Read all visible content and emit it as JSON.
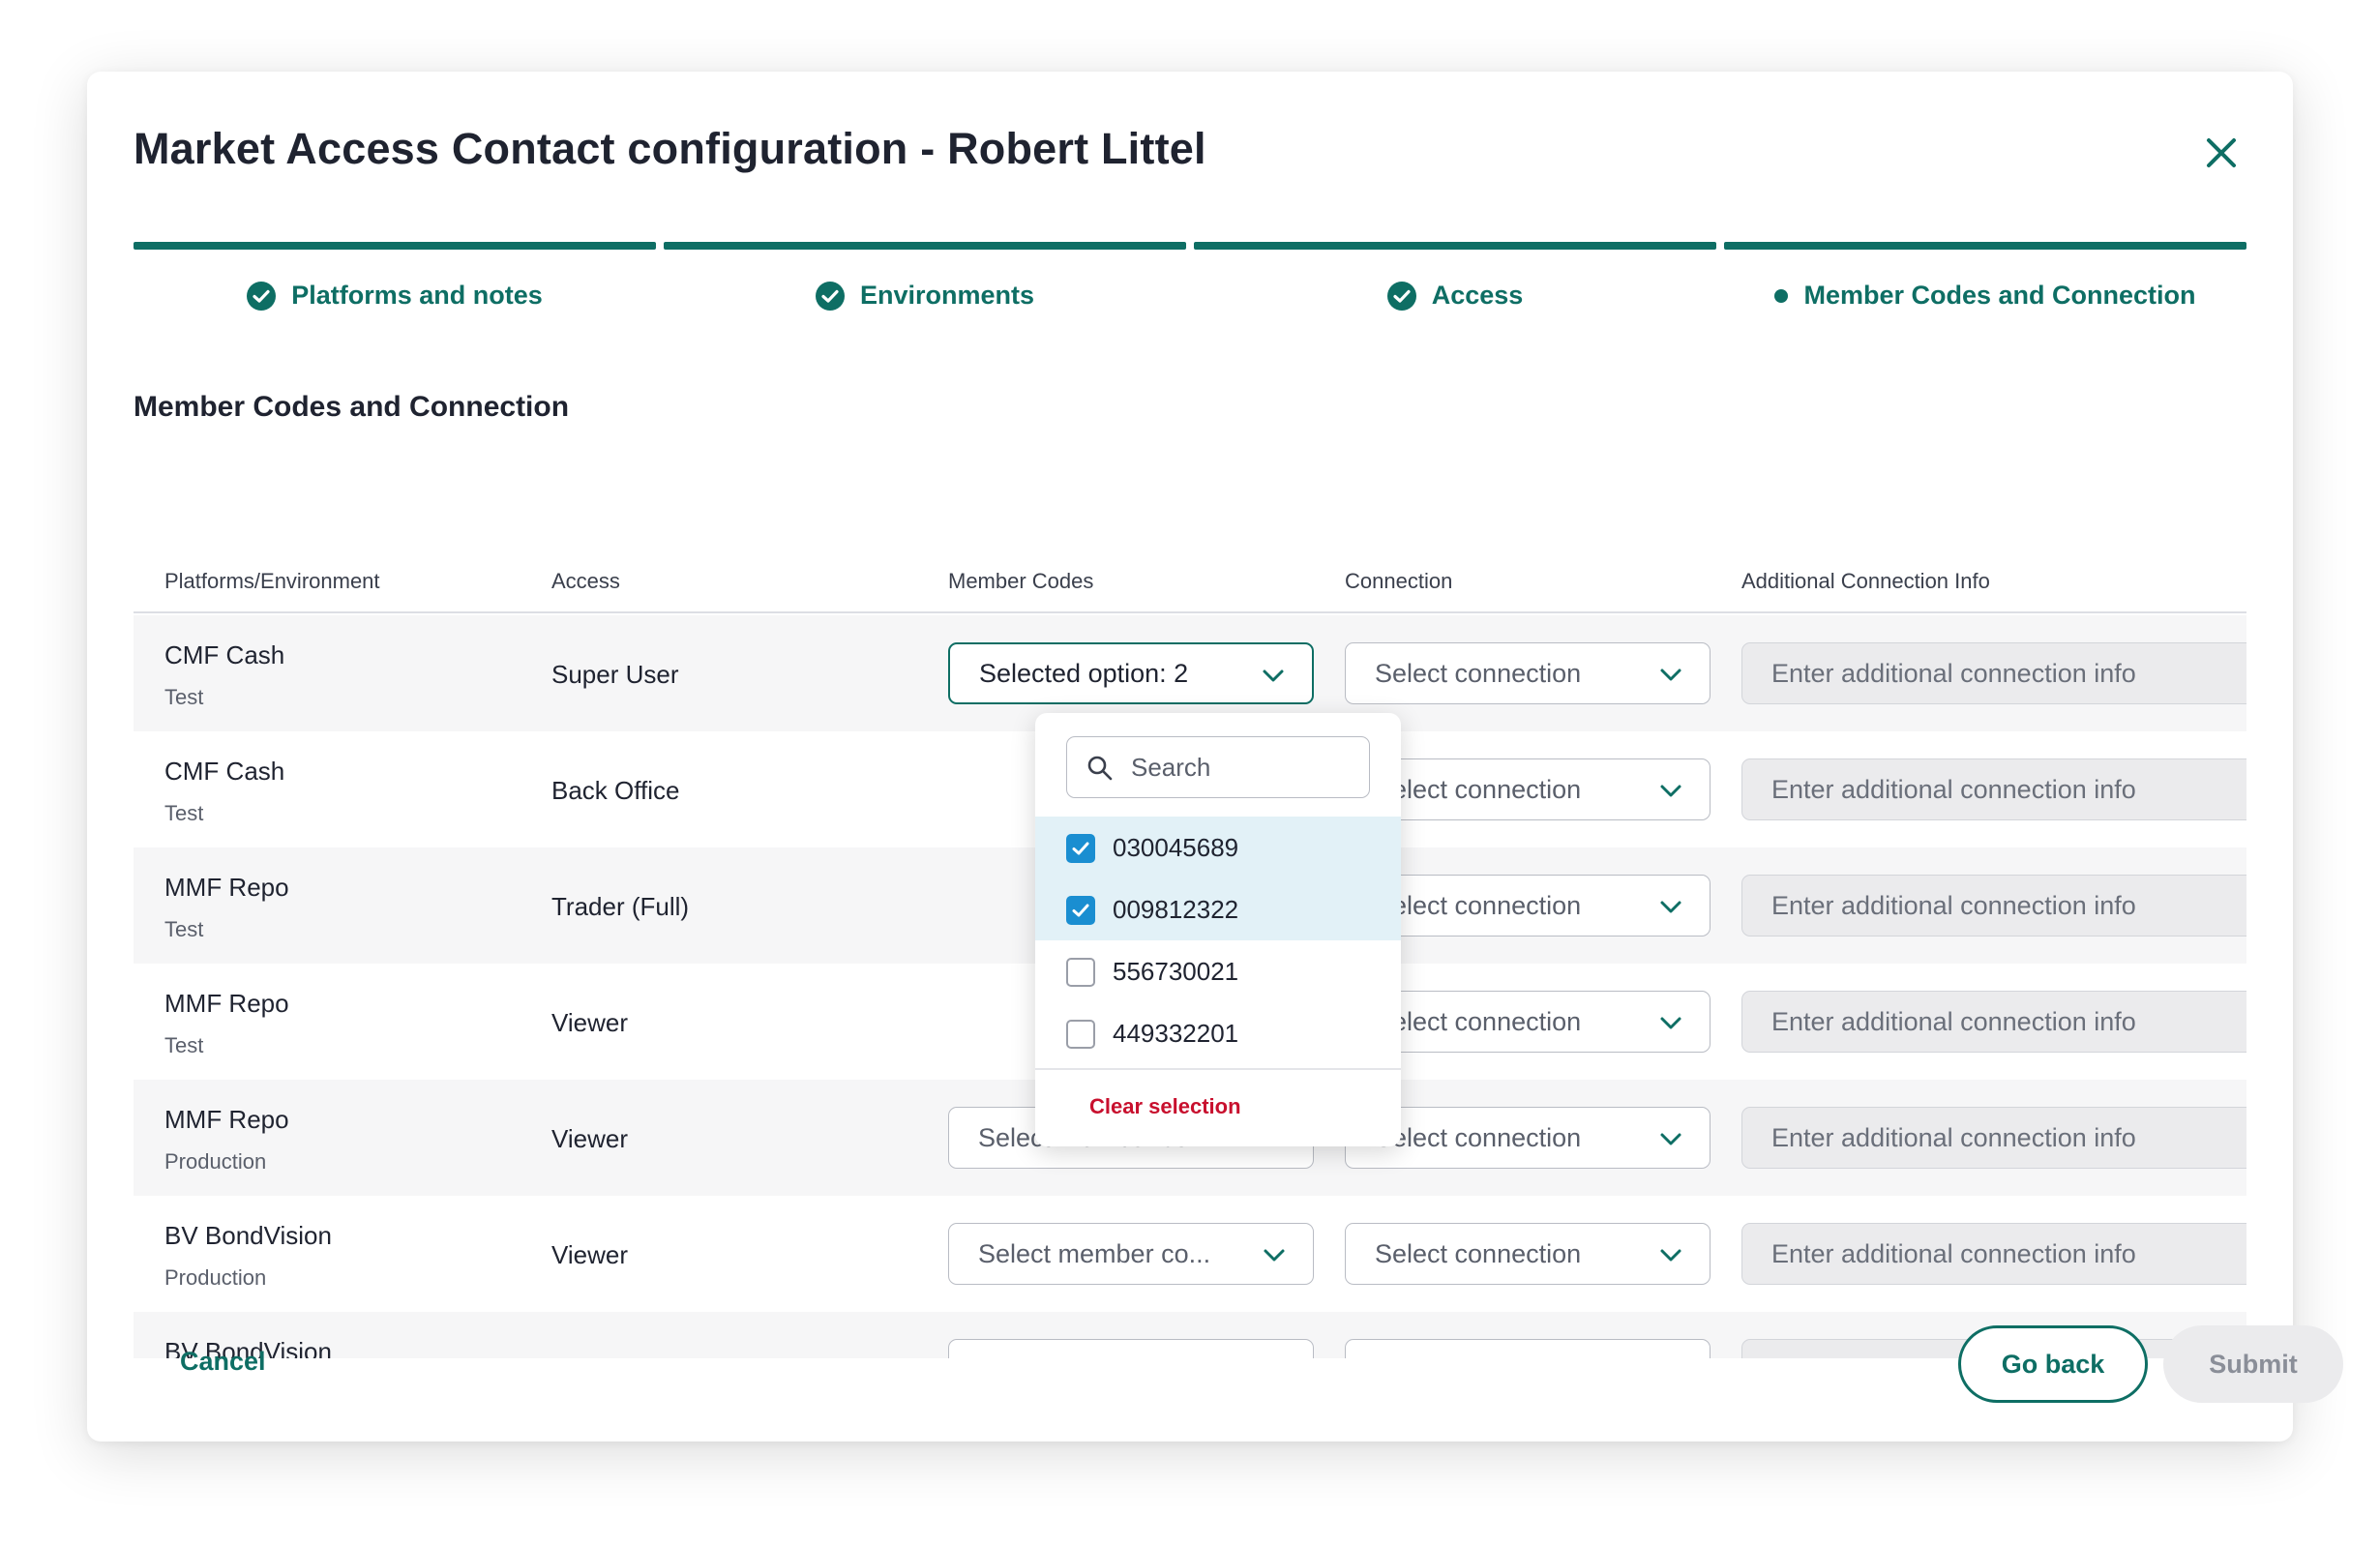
{
  "modal": {
    "title": "Market Access Contact configuration - Robert Littel"
  },
  "stepper": {
    "steps": [
      {
        "label": "Platforms and notes",
        "status": "complete"
      },
      {
        "label": "Environments",
        "status": "complete"
      },
      {
        "label": "Access",
        "status": "complete"
      },
      {
        "label": "Member Codes and Connection",
        "status": "current"
      }
    ]
  },
  "section": {
    "title": "Member Codes and Connection"
  },
  "table": {
    "headers": [
      "Platforms/Environment",
      "Access",
      "Member Codes",
      "Connection",
      "Additional Connection Info"
    ],
    "rows": [
      {
        "platform": "CMF Cash",
        "environment": "Test",
        "access": "Super User",
        "member_codes": "Selected option: 2",
        "connection": "Select connection",
        "info": "Enter additional connection info"
      },
      {
        "platform": "CMF Cash",
        "environment": "Test",
        "access": "Back Office",
        "member_codes": "",
        "connection": "Select connection",
        "info": "Enter additional connection info"
      },
      {
        "platform": "MMF Repo",
        "environment": "Test",
        "access": "Trader (Full)",
        "member_codes": "",
        "connection": "Select connection",
        "info": "Enter additional connection info"
      },
      {
        "platform": "MMF Repo",
        "environment": "Test",
        "access": "Viewer",
        "member_codes": "",
        "connection": "Select connection",
        "info": "Enter additional connection info"
      },
      {
        "platform": "MMF Repo",
        "environment": "Production",
        "access": "Viewer",
        "member_codes": "Select member co...",
        "connection": "Select connection",
        "info": "Enter additional connection info"
      },
      {
        "platform": "BV BondVision",
        "environment": "Production",
        "access": "Viewer",
        "member_codes": "Select member co...",
        "connection": "Select connection",
        "info": "Enter additional connection info"
      },
      {
        "platform": "BV BondVision",
        "environment": "",
        "access": "",
        "member_codes": "",
        "connection": "",
        "info": ""
      }
    ]
  },
  "dropdown": {
    "search_placeholder": "Search",
    "options": [
      {
        "code": "030045689",
        "checked": true
      },
      {
        "code": "009812322",
        "checked": true
      },
      {
        "code": "556730021",
        "checked": false
      },
      {
        "code": "449332201",
        "checked": false
      }
    ],
    "clear_label": "Clear selection"
  },
  "footer": {
    "cancel_label": "Cancel",
    "go_back_label": "Go back",
    "submit_label": "Submit"
  },
  "colors": {
    "primary": "#0e6e64",
    "checkbox": "#1a8ed1",
    "danger": "#c8102e",
    "selected_option_bg": "#e2f1f7"
  },
  "icons": {
    "close": "close-icon",
    "step_complete": "check-circle-icon",
    "step_current": "dot-icon",
    "select_open": "chevron-down-icon",
    "search": "search-icon",
    "checkbox": "checkbox-icon"
  }
}
